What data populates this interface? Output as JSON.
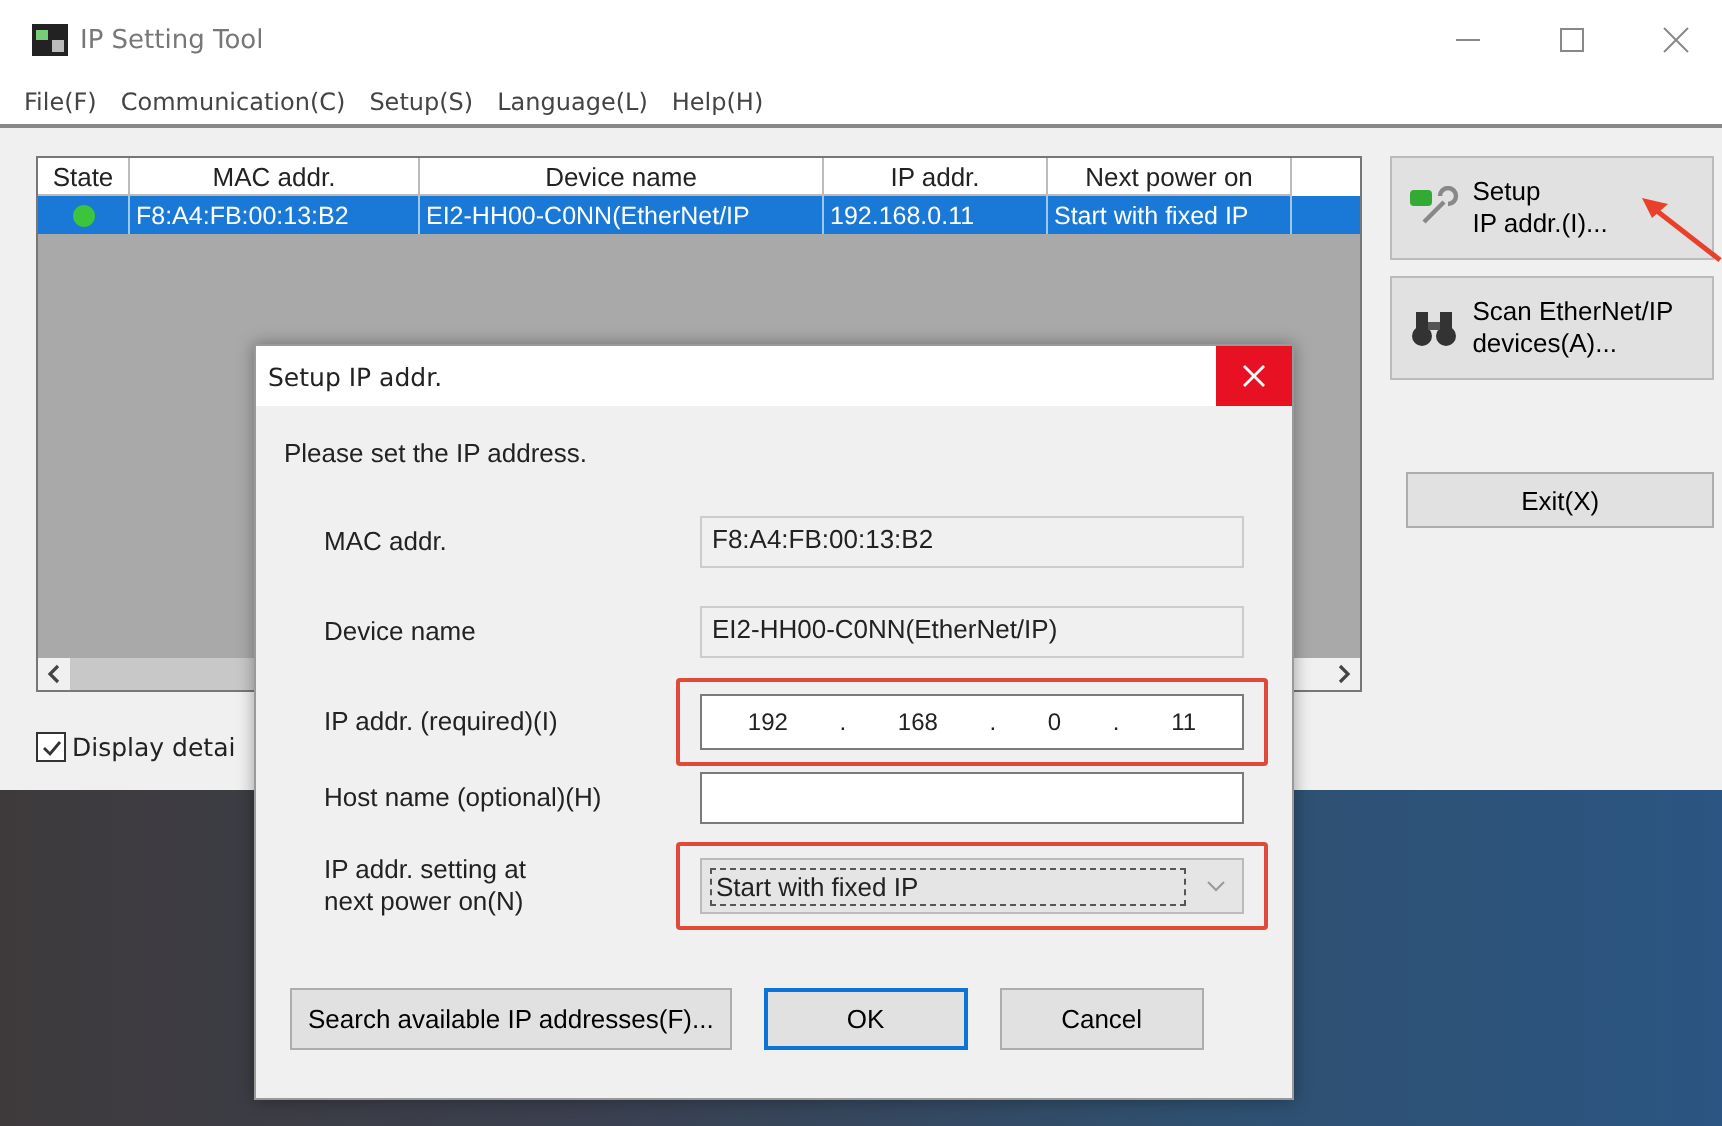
{
  "window": {
    "title": "IP Setting Tool"
  },
  "menu": [
    "File(F)",
    "Communication(C)",
    "Setup(S)",
    "Language(L)",
    "Help(H)"
  ],
  "table": {
    "columns": [
      "State",
      "MAC addr.",
      "Device name",
      "IP addr.",
      "Next power on"
    ],
    "rows": [
      {
        "selected": true,
        "color": "#3cc43c",
        "cells": [
          "",
          "F8:A4:FB:00:13:B2",
          "EI2-HH00-C0NN(EtherNet/IP",
          "192.168.0.11",
          "Start with fixed IP"
        ]
      }
    ]
  },
  "side_buttons": [
    {
      "kind": "setup",
      "label": "Setup\nIP addr.(I)..."
    },
    {
      "kind": "scan",
      "label": "Scan EtherNet/IP\ndevices(A)..."
    }
  ],
  "display_details": {
    "label": "Display detai",
    "checked": true
  },
  "exit_button": "Exit(X)",
  "dialog": {
    "title": "Setup IP addr.",
    "prompt": "Please set the IP address.",
    "fields": [
      {
        "kind": "readonly",
        "label": "MAC addr.",
        "value": "F8:A4:FB:00:13:B2",
        "highlighted": false
      },
      {
        "kind": "readonly",
        "label": "Device name",
        "value": "EI2-HH00-C0NN(EtherNet/IP)",
        "highlighted": false
      },
      {
        "kind": "ip",
        "label": "IP addr. (required)(I)",
        "octets": [
          "192",
          "168",
          "0",
          "11"
        ],
        "separator": ".",
        "highlighted": true
      },
      {
        "kind": "text",
        "label": "Host name (optional)(H)",
        "highlighted": false
      },
      {
        "kind": "select",
        "label": "IP addr. setting at\nnext power on(N)",
        "value": "Start with fixed IP",
        "highlighted": true
      }
    ],
    "buttons": [
      {
        "label": "Search available IP addresses(F)...",
        "default": false
      },
      {
        "label": "OK",
        "default": true
      },
      {
        "label": "Cancel",
        "default": false
      }
    ]
  }
}
